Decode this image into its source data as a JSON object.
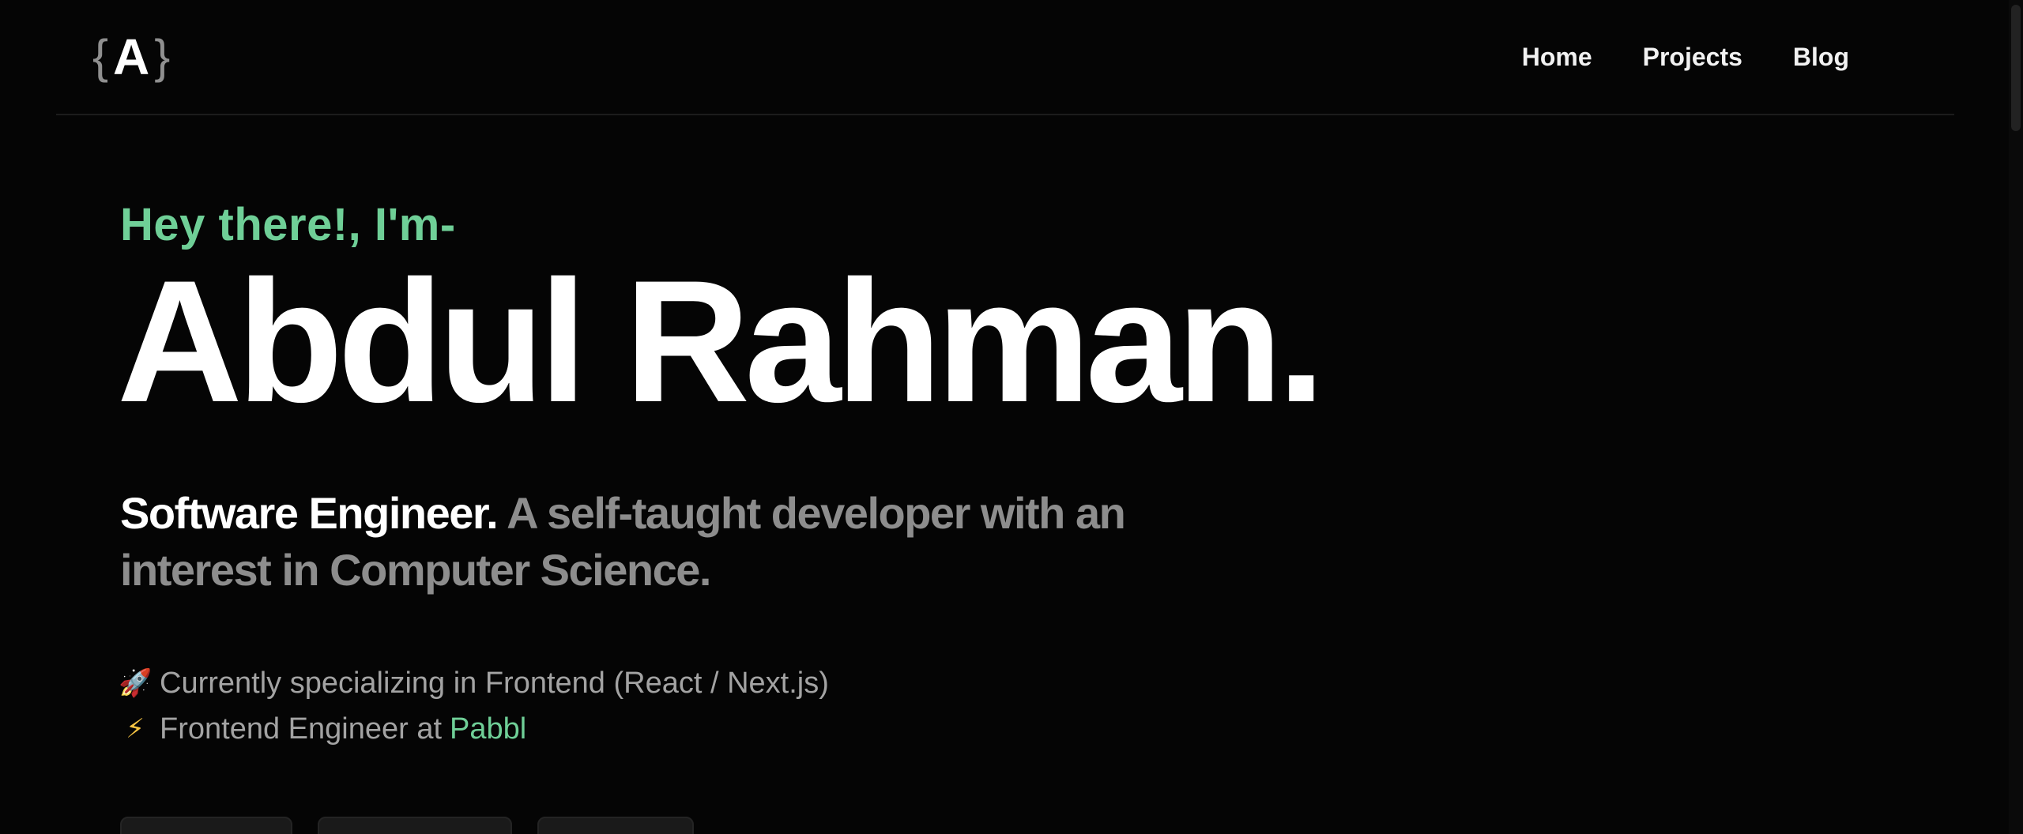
{
  "header": {
    "logo": {
      "open_brace": "{",
      "letter": "A",
      "close_brace": "}"
    },
    "nav": [
      {
        "label": "Home"
      },
      {
        "label": "Projects"
      },
      {
        "label": "Blog"
      }
    ]
  },
  "hero": {
    "greeting": "Hey there!, I'm-",
    "name": "Abdul Rahman.",
    "tagline_strong": "Software Engineer.",
    "tagline_rest": " A self-taught developer with an interest in Computer Science.",
    "facts": [
      {
        "icon": "rocket-icon",
        "glyph": "🚀",
        "text": "Currently specializing in Frontend (React / Next.js)"
      },
      {
        "icon": "lightning-icon",
        "glyph": "⚡",
        "text": "Frontend Engineer at",
        "link": "Pabbl"
      }
    ]
  },
  "colors": {
    "background": "#050505",
    "accent": "#6fcf97",
    "muted_text": "#8d8d8d"
  }
}
